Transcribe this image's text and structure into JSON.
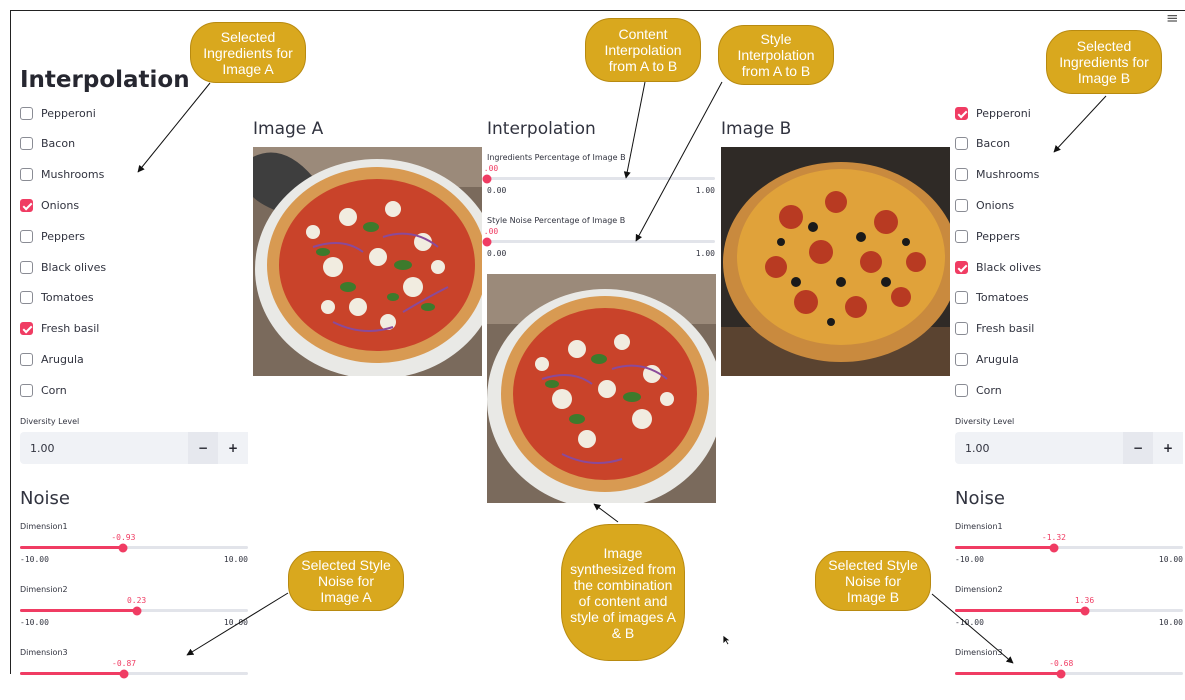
{
  "app": {
    "title": "Interpolation",
    "menu_icon": "hamburger-menu-icon"
  },
  "colors": {
    "accent": "#f03c63",
    "callout": "#d9a81e",
    "input_bg": "#f0f2f6"
  },
  "left_panel": {
    "ingredients": [
      {
        "label": "Pepperoni",
        "checked": false
      },
      {
        "label": "Bacon",
        "checked": false
      },
      {
        "label": "Mushrooms",
        "checked": false
      },
      {
        "label": "Onions",
        "checked": true
      },
      {
        "label": "Peppers",
        "checked": false
      },
      {
        "label": "Black olives",
        "checked": false
      },
      {
        "label": "Tomatoes",
        "checked": false
      },
      {
        "label": "Fresh basil",
        "checked": true
      },
      {
        "label": "Arugula",
        "checked": false
      },
      {
        "label": "Corn",
        "checked": false
      }
    ],
    "diversity_label": "Diversity Level",
    "diversity_value": "1.00",
    "minus": "−",
    "plus": "+",
    "noise_title": "Noise",
    "noise": [
      {
        "label": "Dimension1",
        "value": "-0.93",
        "num": -0.93,
        "min": "-10.00",
        "max": "10.00"
      },
      {
        "label": "Dimension2",
        "value": "0.23",
        "num": 0.23,
        "min": "-10.00",
        "max": "10.00"
      },
      {
        "label": "Dimension3",
        "value": "-0.87",
        "num": -0.87
      }
    ]
  },
  "right_panel": {
    "ingredients": [
      {
        "label": "Pepperoni",
        "checked": true
      },
      {
        "label": "Bacon",
        "checked": false
      },
      {
        "label": "Mushrooms",
        "checked": false
      },
      {
        "label": "Onions",
        "checked": false
      },
      {
        "label": "Peppers",
        "checked": false
      },
      {
        "label": "Black olives",
        "checked": true
      },
      {
        "label": "Tomatoes",
        "checked": false
      },
      {
        "label": "Fresh basil",
        "checked": false
      },
      {
        "label": "Arugula",
        "checked": false
      },
      {
        "label": "Corn",
        "checked": false
      }
    ],
    "diversity_label": "Diversity Level",
    "diversity_value": "1.00",
    "minus": "−",
    "plus": "+",
    "noise_title": "Noise",
    "noise": [
      {
        "label": "Dimension1",
        "value": "-1.32",
        "num": -1.32,
        "min": "-10.00",
        "max": "10.00"
      },
      {
        "label": "Dimension2",
        "value": "1.36",
        "num": 1.36,
        "min": "-10.00",
        "max": "10.00"
      },
      {
        "label": "Dimension3",
        "value": "-0.68",
        "num": -0.68
      }
    ]
  },
  "center": {
    "image_a_title": "Image A",
    "interpolation_title": "Interpolation",
    "image_b_title": "Image B",
    "content_slider": {
      "label": "Ingredients Percentage of Image B",
      "value": ".00",
      "num": 0.0,
      "min": "0.00",
      "max": "1.00"
    },
    "style_slider": {
      "label": "Style Noise Percentage of Image B",
      "value": ".00",
      "num": 0.0,
      "min": "0.00",
      "max": "1.00"
    }
  },
  "callouts": {
    "ingredients_a": "Selected Ingredients for Image A",
    "content_interp": "Content Interpolation from A to B",
    "style_interp": "Style Interpolation from A to B",
    "ingredients_b": "Selected Ingredients for Image B",
    "noise_a": "Selected Style Noise for Image A",
    "synth": "Image synthesized from the combination of content and style of images A & B",
    "noise_b": "Selected Style Noise for Image B"
  }
}
